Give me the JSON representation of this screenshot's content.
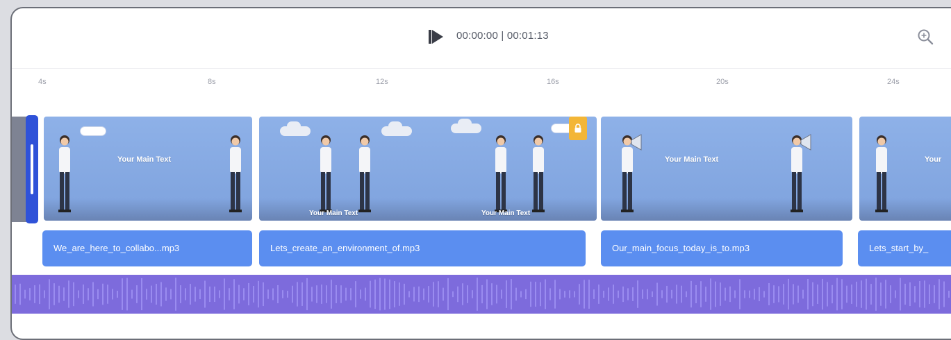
{
  "player": {
    "timecode": "00:00:00 | 00:01:13"
  },
  "icons": {
    "play": "play-icon",
    "zoom": "zoom-in-icon"
  },
  "ruler": {
    "ticks": [
      "4s",
      "8s",
      "12s",
      "16s",
      "20s",
      "24s"
    ]
  },
  "scenes": [
    {
      "title": "Your Main Text"
    },
    {
      "title_left": "Your Main Text",
      "title_right": "Your Main Text"
    },
    {
      "title": "Your Main Text"
    },
    {
      "title": "Your"
    }
  ],
  "audio_clips": [
    {
      "label": "We_are_here_to_collabo...mp3"
    },
    {
      "label": "Lets_create_an_environment_of.mp3"
    },
    {
      "label": "Our_main_focus_today_is_to.mp3"
    },
    {
      "label": "Lets_start_by_"
    }
  ],
  "colors": {
    "scene_bg": "#86a9e3",
    "audio_clip": "#5b8ef0",
    "waveform": "#7d6bdc",
    "waveform_bars": "#9a8cf0",
    "playhead": "#2f52d8",
    "badge": "#f3b637"
  }
}
